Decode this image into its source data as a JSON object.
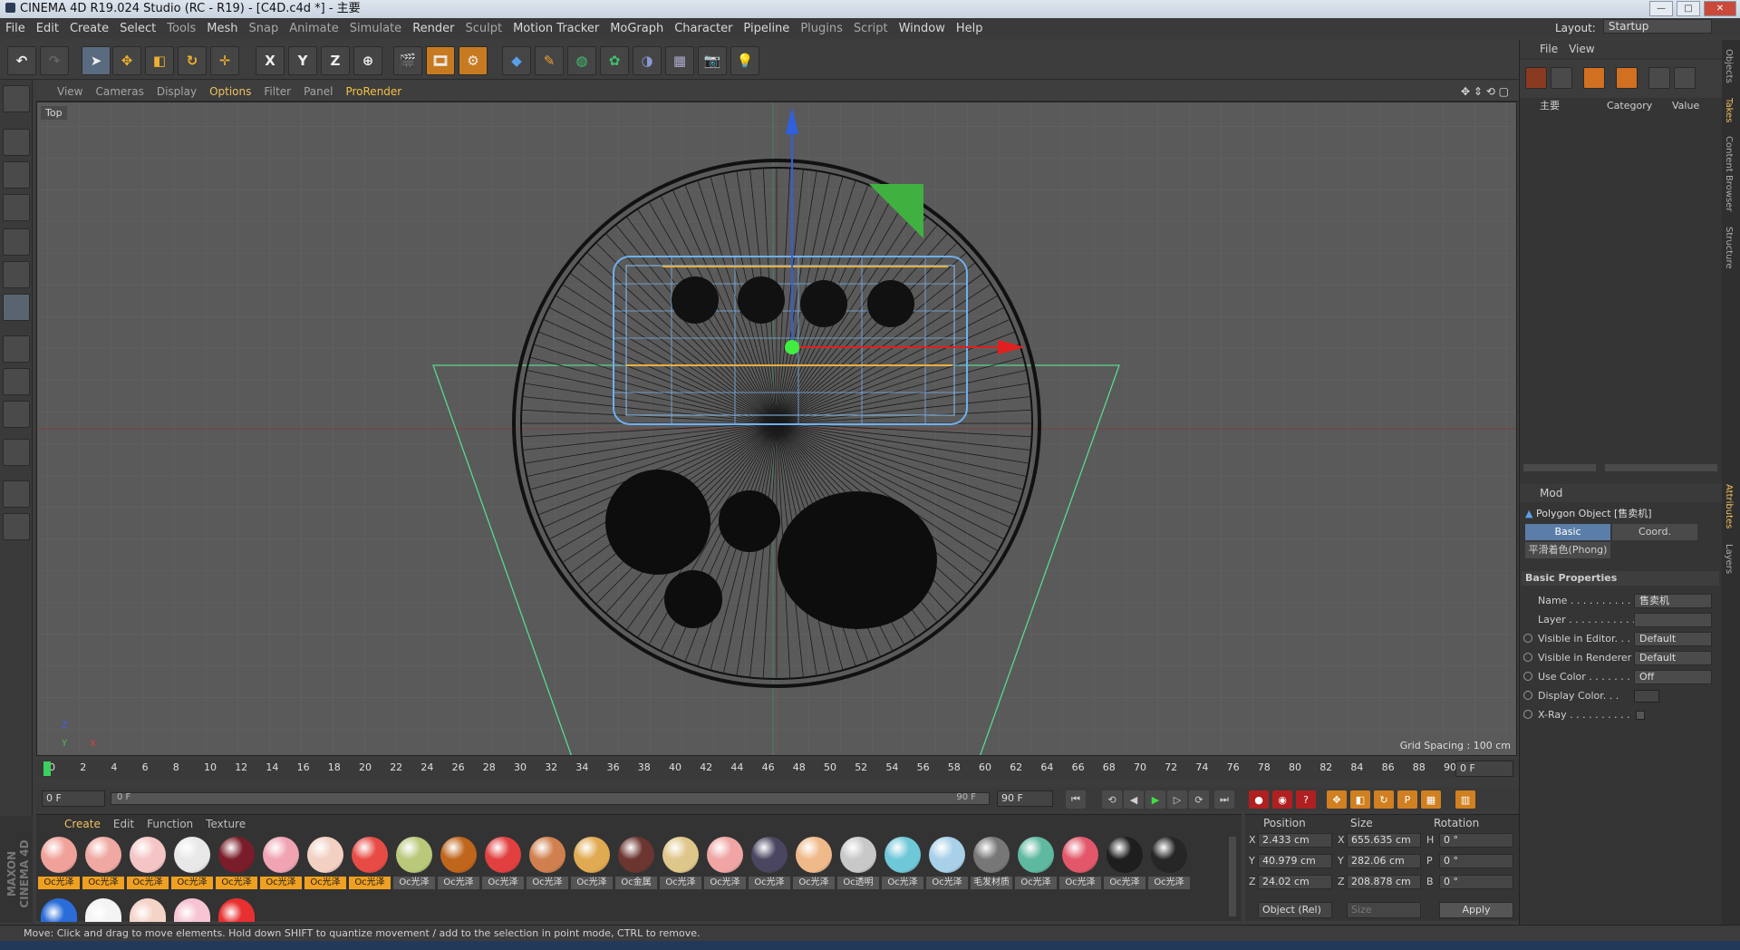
{
  "title": "CINEMA 4D R19.024 Studio (RC - R19) - [C4D.c4d *] - 主要",
  "window_controls": {
    "min": "—",
    "max": "□",
    "close": "✕"
  },
  "menu": [
    "File",
    "Edit",
    "Create",
    "Select",
    "Tools",
    "Mesh",
    "Snap",
    "Animate",
    "Simulate",
    "Render",
    "Sculpt",
    "Motion Tracker",
    "MoGraph",
    "Character",
    "Pipeline",
    "Plugins",
    "Script",
    "Window",
    "Help"
  ],
  "layout": {
    "label": "Layout:",
    "value": "Startup"
  },
  "toolbar_axis": [
    "X",
    "Y",
    "Z"
  ],
  "viewport": {
    "menu": [
      "View",
      "Cameras",
      "Display",
      "Options",
      "Filter",
      "Panel",
      "ProRender"
    ],
    "label": "Top",
    "grid_spacing": "Grid Spacing : 100 cm",
    "axis_z": "Z",
    "axis_x": "X",
    "axis_y": "Y"
  },
  "timeline": {
    "ticks": [
      "0",
      "2",
      "4",
      "6",
      "8",
      "10",
      "12",
      "14",
      "16",
      "18",
      "20",
      "22",
      "24",
      "26",
      "28",
      "30",
      "32",
      "34",
      "36",
      "38",
      "40",
      "42",
      "44",
      "46",
      "48",
      "50",
      "52",
      "54",
      "56",
      "58",
      "60",
      "62",
      "64",
      "66",
      "68",
      "70",
      "72",
      "74",
      "76",
      "78",
      "80",
      "82",
      "84",
      "86",
      "88",
      "90"
    ],
    "current": "0 F"
  },
  "timeline2": {
    "start": "0 F",
    "range_start": "0 F",
    "range_end": "90 F",
    "end": "90 F"
  },
  "materials": {
    "menu": [
      "Create",
      "Edit",
      "Function",
      "Texture"
    ],
    "row1": [
      {
        "label": "Oc光泽",
        "color": "#f0a29a",
        "hl": true
      },
      {
        "label": "Oc光泽",
        "color": "#f0a8a2",
        "hl": true
      },
      {
        "label": "Oc光泽",
        "color": "#f5c5c6",
        "hl": true
      },
      {
        "label": "Oc光泽",
        "color": "#e8e8e8",
        "hl": true
      },
      {
        "label": "Oc光泽",
        "color": "#7a1d2a",
        "hl": true
      },
      {
        "label": "Oc光泽",
        "color": "#f0a3b2",
        "hl": true
      },
      {
        "label": "Oc光泽",
        "color": "#f2d0c2",
        "hl": true
      },
      {
        "label": "Oc光泽",
        "color": "#e84b45",
        "hl": true
      },
      {
        "label": "Oc光泽",
        "color": "#b9c97a",
        "hl": false
      },
      {
        "label": "Oc光泽",
        "color": "#c0651c",
        "hl": false
      },
      {
        "label": "Oc光泽",
        "color": "#e24040",
        "hl": false
      },
      {
        "label": "Oc光泽",
        "color": "#d0804e",
        "hl": false
      },
      {
        "label": "Oc光泽",
        "color": "#e0aa52",
        "hl": false
      },
      {
        "label": "Oc金属",
        "color": "#6b3530",
        "hl": false
      },
      {
        "label": "Oc光泽",
        "color": "#dfc68a",
        "hl": false
      },
      {
        "label": "Oc光泽",
        "color": "#f0a4a4",
        "hl": false
      },
      {
        "label": "Oc光泽",
        "color": "#4a4660",
        "hl": false
      },
      {
        "label": "Oc光泽",
        "color": "#f0b98a",
        "hl": false
      },
      {
        "label": "Oc透明",
        "color": "#c8c8c8",
        "hl": false
      },
      {
        "label": "Oc光泽",
        "color": "#6fc8d8",
        "hl": false
      },
      {
        "label": "Oc光泽",
        "color": "#a8d0e8",
        "hl": false
      },
      {
        "label": "毛发材质",
        "color": "#777777",
        "hl": false
      },
      {
        "label": "Oc光泽",
        "color": "#5fb8a0",
        "hl": false
      },
      {
        "label": "Oc光泽",
        "color": "#e2576a",
        "hl": false
      },
      {
        "label": "Oc光泽",
        "color": "#1e1e1e",
        "hl": false
      },
      {
        "label": "Oc光泽",
        "color": "#262626",
        "hl": false
      }
    ],
    "row2": [
      {
        "color": "#2a6cd8"
      },
      {
        "color": "#f4f4f4"
      },
      {
        "color": "#f5d4c8"
      },
      {
        "color": "#f6c4d2"
      },
      {
        "color": "#e83030"
      }
    ]
  },
  "coords": {
    "headers": [
      "Position",
      "Size",
      "Rotation"
    ],
    "rows": [
      {
        "axis": "X",
        "pos": "2.433 cm",
        "size_axis": "X",
        "size": "655.635 cm",
        "rot_axis": "H",
        "rot": "0 °"
      },
      {
        "axis": "Y",
        "pos": "40.979 cm",
        "size_axis": "Y",
        "size": "282.06 cm",
        "rot_axis": "P",
        "rot": "0 °"
      },
      {
        "axis": "Z",
        "pos": "24.02 cm",
        "size_axis": "Z",
        "size": "208.878 cm",
        "rot_axis": "B",
        "rot": "0 °"
      }
    ],
    "mode": "Object (Rel)",
    "size_mode": "Size",
    "apply": "Apply"
  },
  "objects": {
    "menu": [
      "File",
      "View"
    ],
    "col_main": "主要",
    "col_category": "Category",
    "col_value": "Value"
  },
  "attributes": {
    "mode": "Mod",
    "object": "Polygon Object [售卖机]",
    "tabs": [
      "Basic",
      "Coord."
    ],
    "phong": "平滑着色(Phong)",
    "section": "Basic Properties",
    "rows": [
      {
        "label": "Name . . . . . . . . . . .",
        "value": "售卖机"
      },
      {
        "label": "Layer . . . . . . . . . . .",
        "value": ""
      },
      {
        "label": "Visible in Editor. . .",
        "value": "Default"
      },
      {
        "label": "Visible in Renderer",
        "value": "Default"
      },
      {
        "label": "Use Color . . . . . . .",
        "value": "Off"
      },
      {
        "label": "Display Color. . .",
        "value": ""
      },
      {
        "label": "X-Ray . . . . . . . . . .",
        "value": ""
      }
    ]
  },
  "side_tabs": [
    "Objects",
    "Takes",
    "Content Browser",
    "Structure",
    "Attributes",
    "Layers"
  ],
  "status": "Move: Click and drag to move elements. Hold down SHIFT to quantize movement / add to the selection in point mode, CTRL to remove.",
  "maxon": "MAXON CINEMA 4D"
}
